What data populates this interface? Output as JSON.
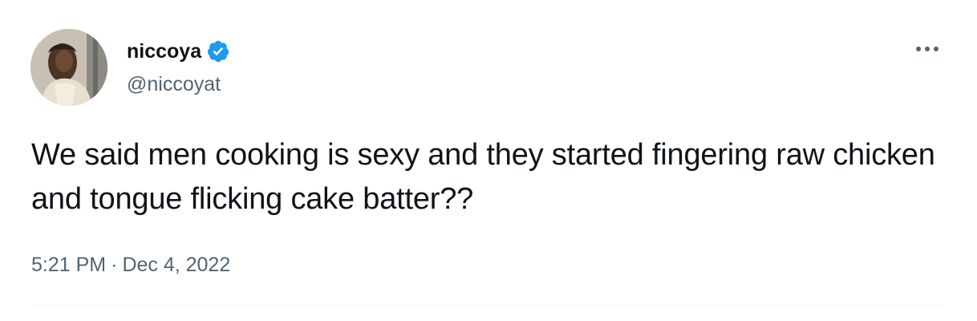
{
  "user": {
    "display_name": "niccoya",
    "handle": "@niccoyat",
    "verified": true,
    "verified_color": "#1d9bf0",
    "avatar_icon": "profile-photo"
  },
  "more_menu": {
    "icon": "ellipsis-icon",
    "glyph": "···"
  },
  "tweet": {
    "text": "We said men cooking is sexy and they started fingering raw chicken and tongue flicking cake batter??",
    "time": "5:21 PM",
    "separator": "·",
    "date": "Dec 4, 2022"
  },
  "colors": {
    "text_primary": "#0f1419",
    "text_secondary": "#536471",
    "divider": "#eff3f4"
  }
}
